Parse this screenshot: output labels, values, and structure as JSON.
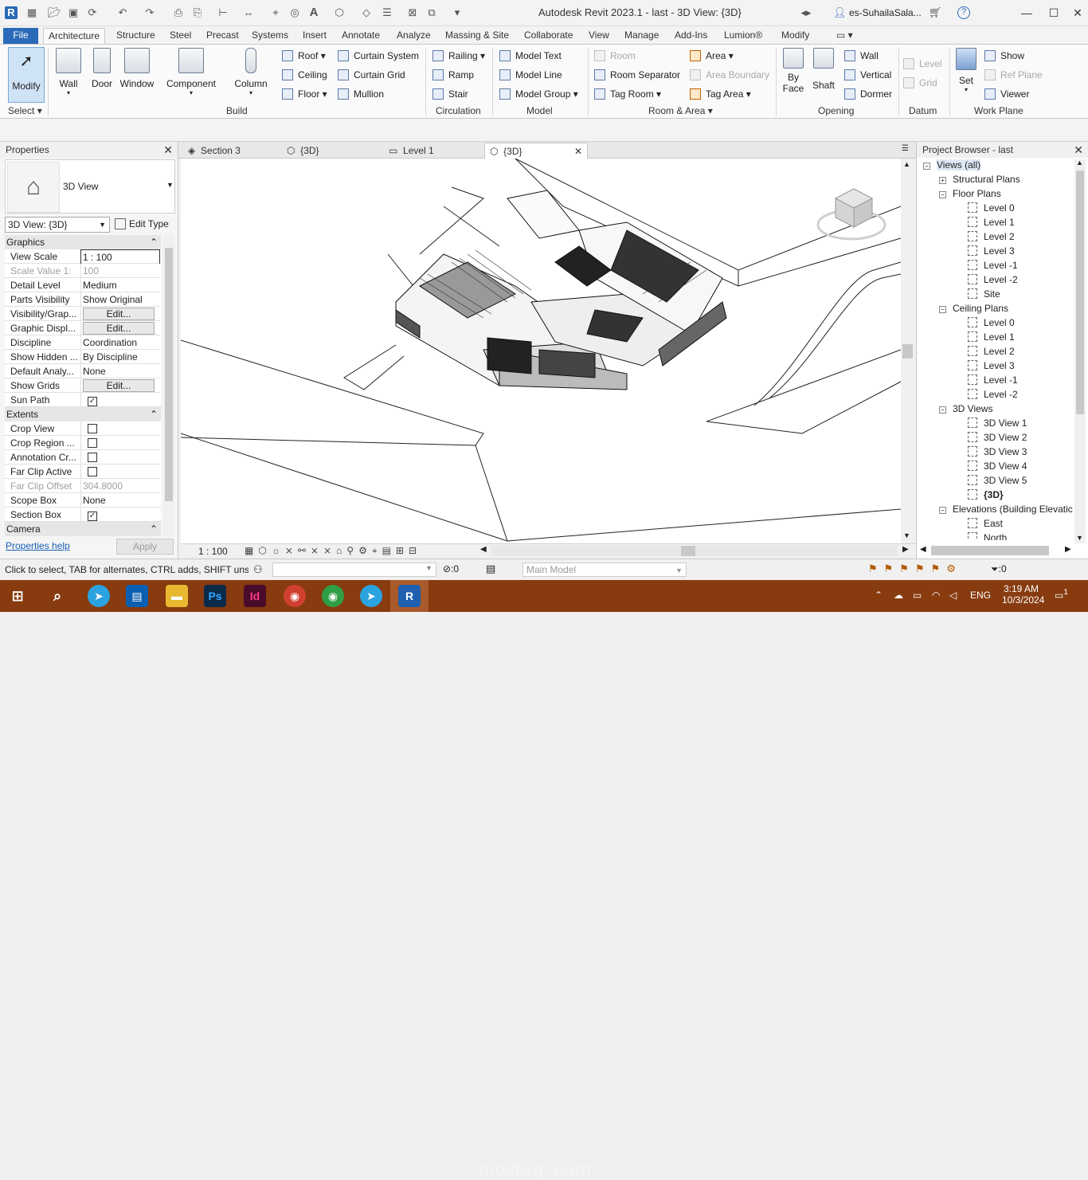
{
  "titlebar": {
    "app_title": "Autodesk Revit 2023.1 - last - 3D View: {3D}",
    "user": "es-SuhailaSala...",
    "help": "?"
  },
  "tabs": {
    "file": "File",
    "items": [
      "Architecture",
      "Structure",
      "Steel",
      "Precast",
      "Systems",
      "Insert",
      "Annotate",
      "Analyze",
      "Massing & Site",
      "Collaborate",
      "View",
      "Manage",
      "Add-Ins",
      "Lumion®",
      "Modify"
    ]
  },
  "ribbon": {
    "select": {
      "modify": "Modify",
      "label": "Select"
    },
    "build": {
      "label": "Build",
      "wall": "Wall",
      "door": "Door",
      "window": "Window",
      "component": "Component",
      "column": "Column",
      "roof": "Roof",
      "ceiling": "Ceiling",
      "floor": "Floor",
      "curtain_system": "Curtain  System",
      "curtain_grid": "Curtain  Grid",
      "mullion": "Mullion"
    },
    "circulation": {
      "label": "Circulation",
      "railing": "Railing",
      "ramp": "Ramp",
      "stair": "Stair"
    },
    "model": {
      "label": "Model",
      "text": "Model  Text",
      "line": "Model  Line",
      "group": "Model  Group"
    },
    "room_area": {
      "label": "Room & Area",
      "room": "Room",
      "room_separator": "Room  Separator",
      "tag_room": "Tag  Room",
      "area": "Area",
      "area_boundary": "Area  Boundary",
      "tag_area": "Tag  Area"
    },
    "opening": {
      "label": "Opening",
      "by_face": "By Face",
      "shaft": "Shaft",
      "wall": "Wall",
      "vertical": "Vertical",
      "dormer": "Dormer"
    },
    "datum": {
      "label": "Datum",
      "level": "Level",
      "grid": "Grid"
    },
    "work_plane": {
      "label": "Work Plane",
      "set": "Set",
      "show": "Show",
      "ref_plane": "Ref  Plane",
      "viewer": "Viewer"
    }
  },
  "properties": {
    "title": "Properties",
    "type_name": "3D View",
    "selector": "3D View: {3D}",
    "edit_type": "Edit Type",
    "sections": {
      "graphics": "Graphics",
      "extents": "Extents",
      "camera": "Camera"
    },
    "graphics_rows": [
      {
        "k": "View Scale",
        "v": "1 : 100"
      },
      {
        "k": "Scale Value    1:",
        "v": "100"
      },
      {
        "k": "Detail Level",
        "v": "Medium"
      },
      {
        "k": "Parts Visibility",
        "v": "Show Original"
      },
      {
        "k": "Visibility/Grap...",
        "v": "Edit..."
      },
      {
        "k": "Graphic Displ...",
        "v": "Edit..."
      },
      {
        "k": "Discipline",
        "v": "Coordination"
      },
      {
        "k": "Show Hidden ...",
        "v": "By Discipline"
      },
      {
        "k": "Default Analy...",
        "v": "None"
      },
      {
        "k": "Show Grids",
        "v": "Edit..."
      },
      {
        "k": "Sun Path",
        "v": "☑"
      }
    ],
    "extents_rows": [
      {
        "k": "Crop View",
        "v": ""
      },
      {
        "k": "Crop Region ...",
        "v": ""
      },
      {
        "k": "Annotation Cr...",
        "v": ""
      },
      {
        "k": "Far Clip Active",
        "v": ""
      },
      {
        "k": "Far Clip Offset",
        "v": "304.8000"
      },
      {
        "k": "Scope Box",
        "v": "None"
      },
      {
        "k": "Section Box",
        "v": "☑"
      }
    ],
    "help_link": "Properties help",
    "apply": "Apply"
  },
  "view_tabs": [
    "Section 3",
    "{3D}",
    "Level 1",
    "{3D}"
  ],
  "view_scale": "1 : 100",
  "browser": {
    "title": "Project Browser - last",
    "root": "Views (all)",
    "structural_plans": "Structural Plans",
    "floor_plans": "Floor Plans",
    "floor_items": [
      "Level 0",
      "Level 1",
      "Level 2",
      "Level 3",
      "Level -1",
      "Level -2",
      "Site"
    ],
    "ceiling_plans": "Ceiling Plans",
    "ceiling_items": [
      "Level 0",
      "Level 1",
      "Level 2",
      "Level 3",
      "Level -1",
      "Level -2"
    ],
    "views_3d": "3D Views",
    "views_3d_items": [
      "3D View 1",
      "3D View 2",
      "3D View 3",
      "3D View 4",
      "3D View 5",
      "{3D}"
    ],
    "elevations": "Elevations (Building Elevatic",
    "elevation_items": [
      "East",
      "North"
    ]
  },
  "statusbar": {
    "hint": "Click to select, TAB for alternates, CTRL adds, SHIFT unsele",
    "count": ":0",
    "model": "Main Model",
    "filter_count": ":0"
  },
  "taskbar": {
    "lang": "ENG",
    "time": "3:19 AM",
    "date": "10/3/2024",
    "notif": "1",
    "watermark": "mostaql.com"
  },
  "colors": {
    "file_tab": "#2a6ab8",
    "taskbar": "#873b0f",
    "modify_highlight": "#cfe3f7"
  }
}
